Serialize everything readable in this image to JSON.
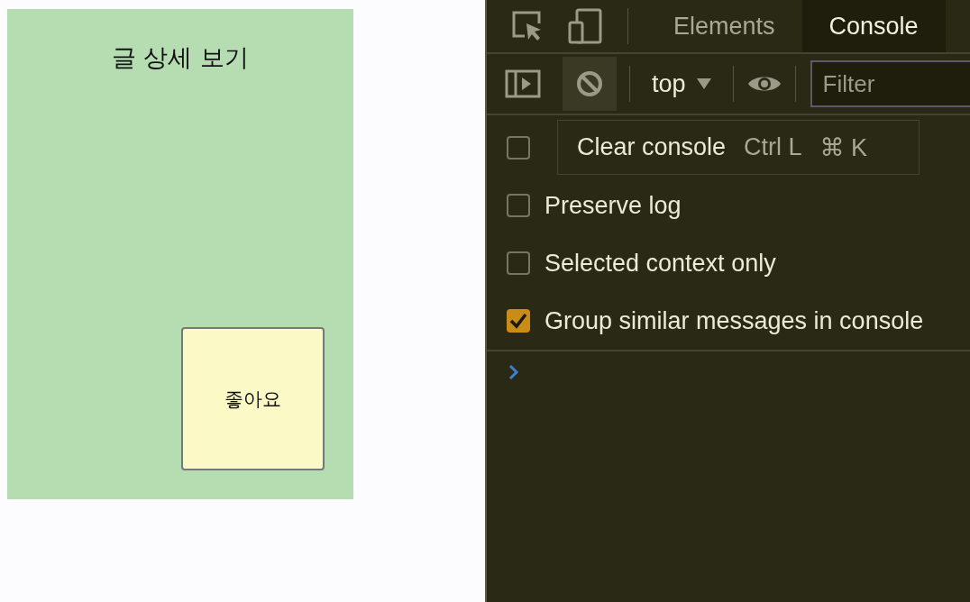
{
  "page": {
    "title": "글 상세 보기",
    "like_button": "좋아요"
  },
  "devtools": {
    "tabs": [
      {
        "label": "Elements",
        "selected": false
      },
      {
        "label": "Console",
        "selected": true
      }
    ],
    "toolbar": {
      "context": "top",
      "filter": {
        "placeholder": "Filter"
      }
    },
    "settings": [
      {
        "checked": false
      },
      {
        "label": "Preserve log",
        "checked": false
      },
      {
        "label": "Selected context only",
        "checked": false
      },
      {
        "label": "Group similar messages in console",
        "checked": true
      }
    ],
    "tooltip": {
      "label": "Clear console",
      "shortcuts": [
        "Ctrl L",
        "⌘ K"
      ]
    }
  }
}
